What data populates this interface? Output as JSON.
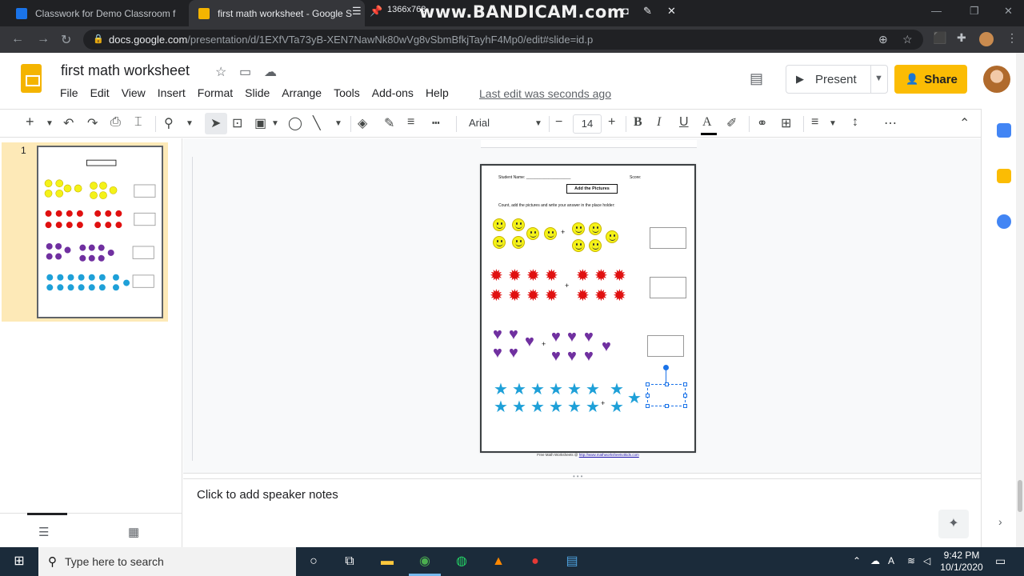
{
  "browser": {
    "tabs": [
      {
        "title": "Classwork for Demo Classroom f",
        "active": false,
        "favicon_color": "#1a73e8"
      },
      {
        "title": "first math worksheet - Google S",
        "active": true,
        "favicon_color": "#f4b400"
      }
    ],
    "recorder": {
      "resolution": "1366x768",
      "watermark": "www.BANDICAM.com"
    },
    "url_host": "docs.google.com",
    "url_path": "/presentation/d/1EXfVTa73yB-XEN7NawNk80wVg8vSbmBfkjTayhF4Mp0/edit#slide=id.p"
  },
  "header": {
    "title": "first math worksheet",
    "menu": [
      "File",
      "Edit",
      "View",
      "Insert",
      "Format",
      "Slide",
      "Arrange",
      "Tools",
      "Add-ons",
      "Help"
    ],
    "last_edit": "Last edit was seconds ago",
    "present_label": "Present",
    "share_label": "Share"
  },
  "toolbar": {
    "font": "Arial",
    "font_size": "14"
  },
  "filmstrip": {
    "slide_number": "1"
  },
  "slide": {
    "student_label": "Student Name: ____________________",
    "score_label": "Score:",
    "title": "Add the Pictures",
    "instruction": "Count, add the pictures and write your answer in the place holder:",
    "footer_text": "Free Math Worksheets @",
    "footer_link": "http://www.mathworksheets4kids.com",
    "plus": "+"
  },
  "notes": {
    "placeholder": "Click to add speaker notes"
  },
  "taskbar": {
    "search_placeholder": "Type here to search",
    "time": "9:42 PM",
    "date": "10/1/2020"
  },
  "colors": {
    "share_button": "#fbbc04",
    "slides_brand": "#f4b400",
    "selection": "#1a73e8",
    "smiley": "#f4f218",
    "red_star": "#e01010",
    "heart": "#7030a0",
    "blue_star": "#1ea0d8"
  }
}
